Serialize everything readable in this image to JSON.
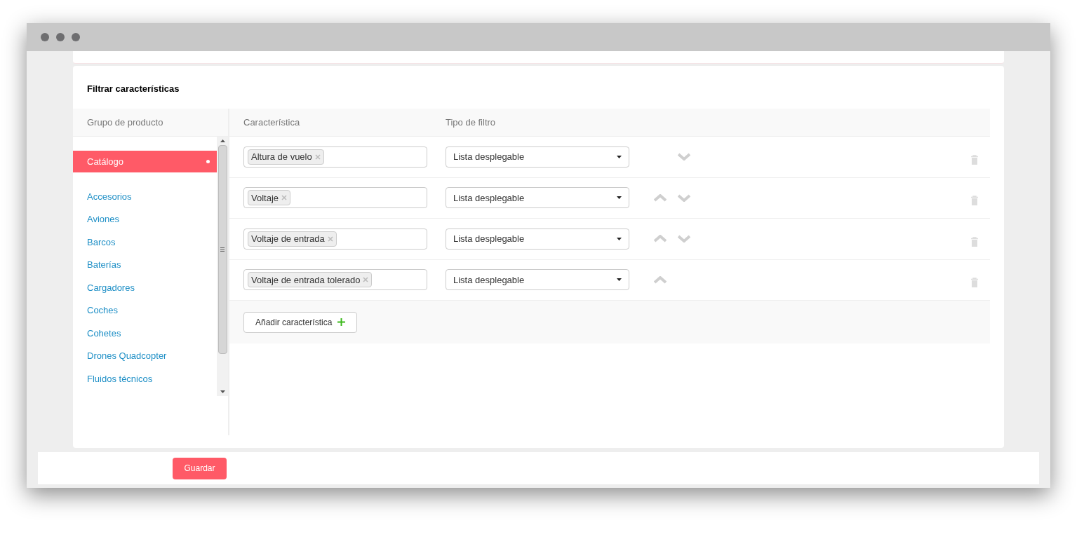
{
  "card": {
    "title": "Filtrar características"
  },
  "groups": {
    "header": "Grupo de producto",
    "items": [
      {
        "label": "Catálogo",
        "selected": true
      },
      {
        "label": "Accesorios",
        "selected": false
      },
      {
        "label": "Aviones",
        "selected": false
      },
      {
        "label": "Barcos",
        "selected": false
      },
      {
        "label": "Baterías",
        "selected": false
      },
      {
        "label": "Cargadores",
        "selected": false
      },
      {
        "label": "Coches",
        "selected": false
      },
      {
        "label": "Cohetes",
        "selected": false
      },
      {
        "label": "Drones Quadcopter",
        "selected": false
      },
      {
        "label": "Fluidos técnicos",
        "selected": false
      }
    ]
  },
  "columns": [
    "Característica",
    "Tipo de filtro"
  ],
  "rows": [
    {
      "tag": "Altura de vuelo",
      "filter": "Lista desplegable",
      "can_move_up": false,
      "can_move_down": true
    },
    {
      "tag": "Voltaje",
      "filter": "Lista desplegable",
      "can_move_up": true,
      "can_move_down": true
    },
    {
      "tag": "Voltaje de entrada",
      "filter": "Lista desplegable",
      "can_move_up": true,
      "can_move_down": true
    },
    {
      "tag": "Voltaje de entrada tolerado",
      "filter": "Lista desplegable",
      "can_move_up": true,
      "can_move_down": false
    }
  ],
  "add_button": "Añadir característica",
  "save_button": "Guardar"
}
